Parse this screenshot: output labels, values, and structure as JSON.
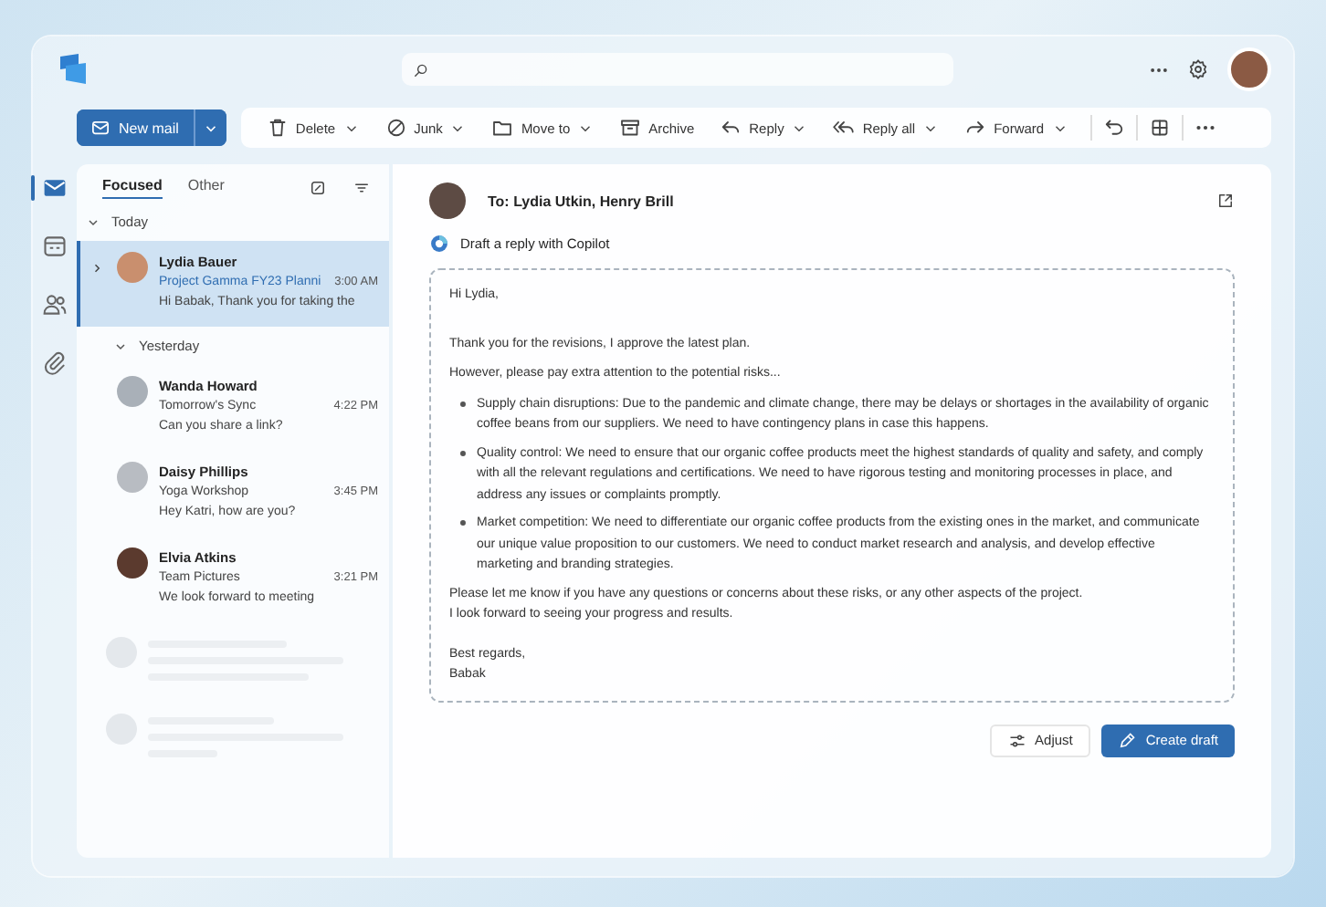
{
  "toolbar": {
    "new_mail": "New mail",
    "actions": [
      {
        "kind": "delete",
        "label": "Delete",
        "dropdown": true
      },
      {
        "kind": "junk",
        "label": "Junk",
        "dropdown": true
      },
      {
        "kind": "move",
        "label": "Move to",
        "dropdown": true
      },
      {
        "kind": "archive",
        "label": "Archive",
        "dropdown": false
      },
      {
        "kind": "reply",
        "label": "Reply",
        "dropdown": true
      },
      {
        "kind": "replyall",
        "label": "Reply all",
        "dropdown": true
      },
      {
        "kind": "forward",
        "label": "Forward",
        "dropdown": true
      }
    ]
  },
  "rail": [
    {
      "kind": "mail",
      "selected": true
    },
    {
      "kind": "calendar",
      "selected": false
    },
    {
      "kind": "people",
      "selected": false
    },
    {
      "kind": "attach",
      "selected": false
    }
  ],
  "mail_list": {
    "tabs": [
      {
        "label": "Focused",
        "selected": true
      },
      {
        "label": "Other",
        "selected": false
      }
    ],
    "groups": [
      {
        "label": "Today",
        "expanded": true,
        "messages": [
          {
            "sender": "Lydia Bauer",
            "subject": "Project Gamma FY23 Planni",
            "time": "3:00 AM",
            "preview": "Hi Babak, Thank you for taking the",
            "selected": true,
            "thread": true
          }
        ]
      },
      {
        "label": "Yesterday",
        "expanded": true,
        "messages": [
          {
            "sender": "Wanda Howard",
            "subject": "Tomorrow's Sync",
            "time": "4:22 PM",
            "preview": "Can you share a link?",
            "selected": false,
            "thread": false
          },
          {
            "sender": "Daisy Phillips",
            "subject": "Yoga Workshop",
            "time": "3:45 PM",
            "preview": "Hey Katri, how are you?",
            "selected": false,
            "thread": false
          },
          {
            "sender": "Elvia Atkins",
            "subject": "Team Pictures",
            "time": "3:21 PM",
            "preview": "We look forward to meeting",
            "selected": false,
            "thread": false
          }
        ]
      }
    ]
  },
  "reading": {
    "to": "To: Lydia Utkin, Henry Brill",
    "copilot": "Draft a reply with Copilot",
    "draft": [
      {
        "kind": "p",
        "text": "Hi Lydia,"
      },
      {
        "kind": "gap"
      },
      {
        "kind": "p",
        "text": "Thank you for the revisions, I approve the latest plan."
      },
      {
        "kind": "p",
        "text": "However, please pay extra attention to the potential risks..."
      },
      {
        "kind": "bullet",
        "text": "Supply chain disruptions: Due to the pandemic and climate change, there may be delays or shortages in the availability of organic coffee beans from our suppliers. We need to have contingency plans in case this happens."
      },
      {
        "kind": "bullet",
        "text": "Quality control: We need to ensure that our organic coffee products meet the highest standards of quality and safety, and comply with all the relevant regulations and certifications. We need to have rigorous testing and monitoring processes in place, and address any issues or complaints promptly."
      },
      {
        "kind": "bullet",
        "text": "Market competition: We need to differentiate our organic coffee products from the existing ones in the market, and communicate our unique value proposition to our customers. We need to conduct market research and analysis, and develop effective marketing and branding strategies."
      },
      {
        "kind": "line",
        "text": "Please let me know if you have any questions or concerns about these risks, or any other aspects of the project."
      },
      {
        "kind": "line",
        "text": "I look forward to seeing your progress and results."
      },
      {
        "kind": "gap"
      },
      {
        "kind": "line",
        "text": "Best regards,"
      },
      {
        "kind": "line",
        "text": "Babak"
      }
    ],
    "adjust": "Adjust",
    "create": "Create draft"
  }
}
